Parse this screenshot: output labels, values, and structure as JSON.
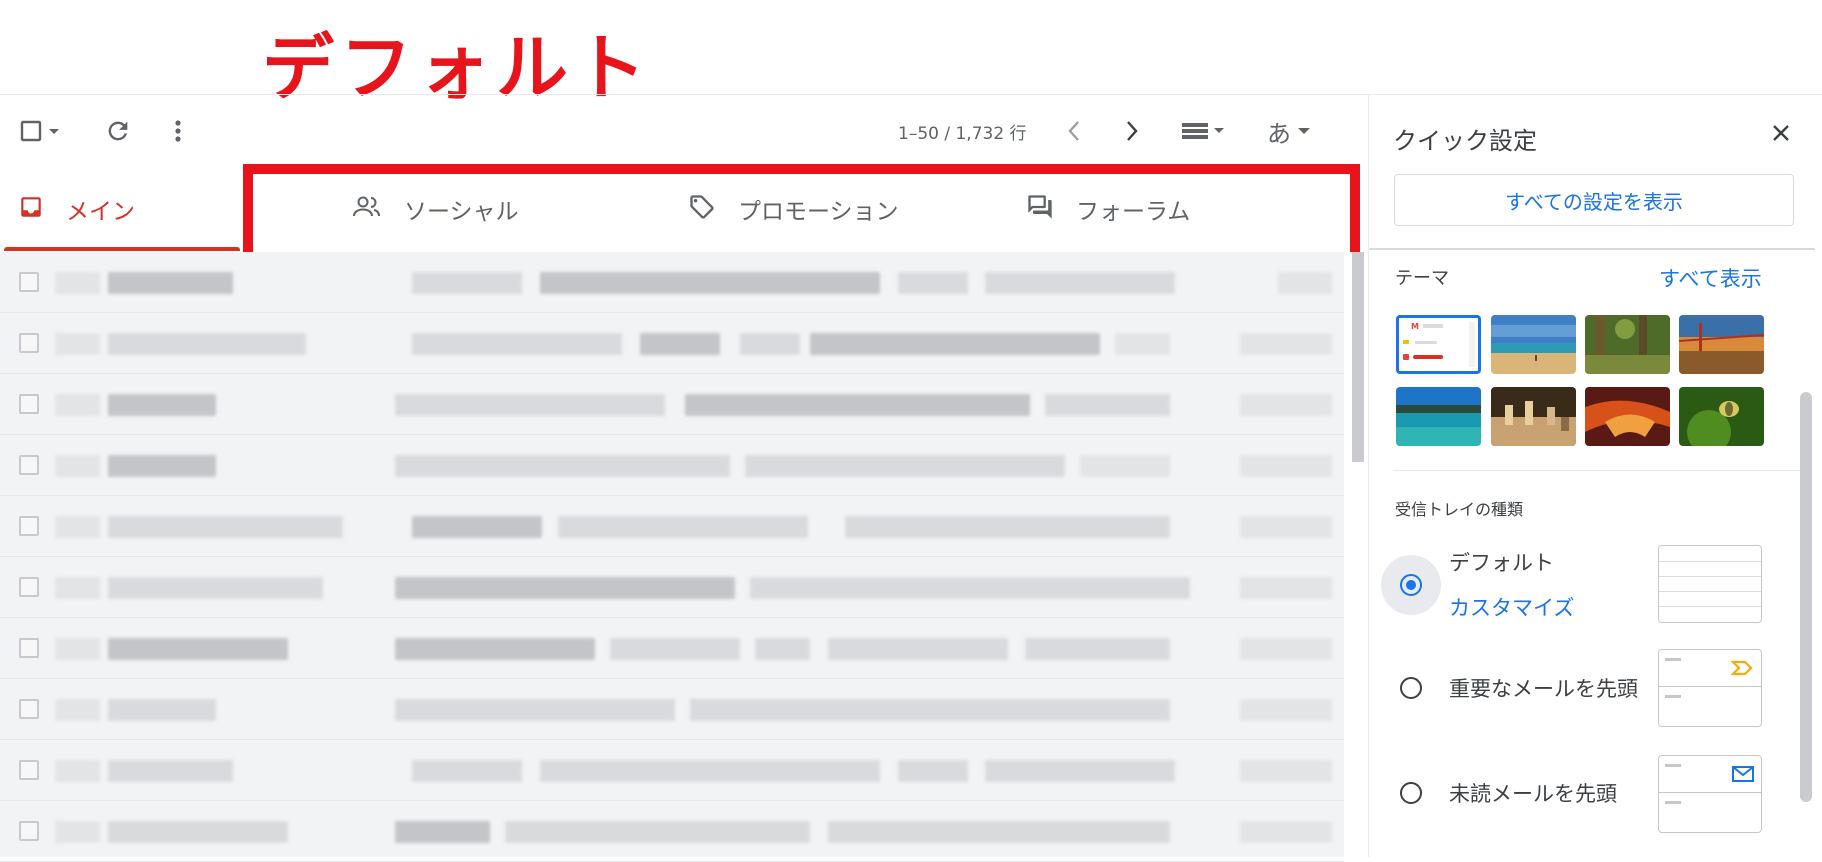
{
  "annotation": {
    "title": "デフォルト",
    "color": "#e8141c"
  },
  "toolbar": {
    "select_icon": "checkbox-dropdown-icon",
    "refresh_icon": "refresh-icon",
    "more_icon": "more-vert-icon",
    "page_info": "1–50 / 1,732 行",
    "prev_icon": "chevron-left-icon",
    "next_icon": "chevron-right-icon",
    "density_icon": "density-icon",
    "input_tools_label": "あ"
  },
  "tabs": [
    {
      "label": "メイン",
      "icon": "inbox-icon",
      "active": true
    },
    {
      "label": "ソーシャル",
      "icon": "people-icon",
      "active": false
    },
    {
      "label": "プロモーション",
      "icon": "tag-icon",
      "active": false
    },
    {
      "label": "フォーラム",
      "icon": "forum-icon",
      "active": false
    }
  ],
  "mail_list": {
    "row_count": 10,
    "content": "blurred"
  },
  "quick_settings": {
    "title": "クイック設定",
    "close_icon": "close-icon",
    "all_settings_button": "すべての設定を表示",
    "theme_label": "テーマ",
    "theme_link": "すべて表示",
    "themes": [
      "default-gmail-theme",
      "beach-theme",
      "forest-theme",
      "bridge-theme",
      "lake-theme",
      "chess-theme",
      "canyon-theme",
      "insect-theme"
    ],
    "inbox_type_label": "受信トレイの種類",
    "inbox_options": [
      {
        "label": "デフォルト",
        "sub_link": "カスタマイズ",
        "selected": true
      },
      {
        "label": "重要なメールを先頭",
        "selected": false,
        "preview_icon": "important-marker-icon"
      },
      {
        "label": "未読メールを先頭",
        "selected": false,
        "preview_icon": "envelope-icon"
      }
    ]
  },
  "colors": {
    "accent_red": "#d93025",
    "link_blue": "#1a73e8",
    "annotation_red": "#e8141c"
  }
}
